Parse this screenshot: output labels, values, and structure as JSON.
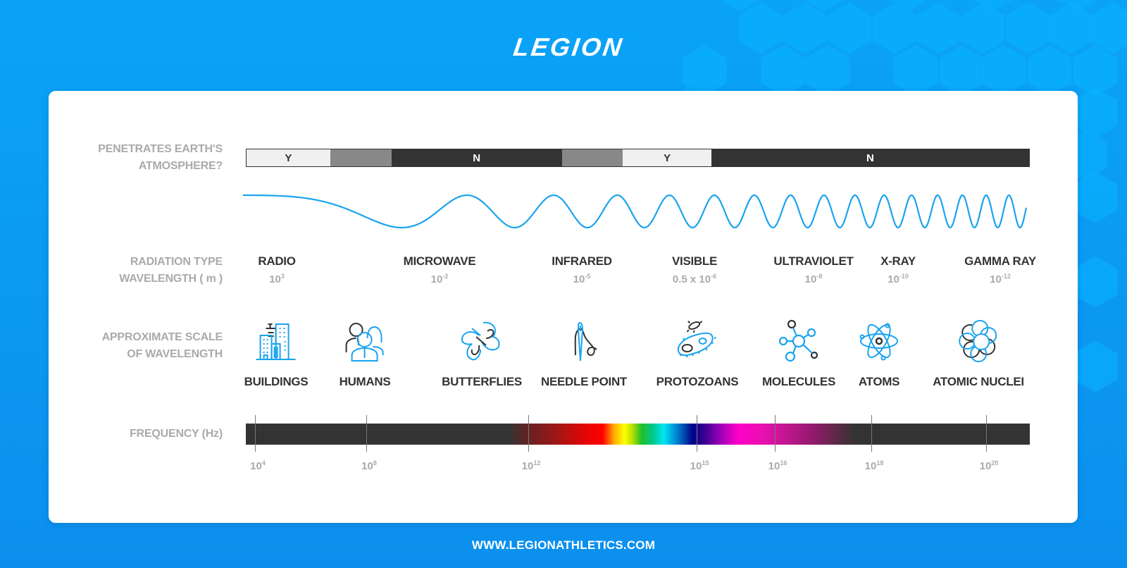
{
  "brand": {
    "logo_text": "LEGION",
    "website": "WWW.LEGIONATHLETICS.COM",
    "colors": {
      "background": "#0a9df5",
      "accent_blue": "#1aa3ef",
      "dark": "#333333",
      "muted": "#aaaaaa",
      "light": "#f0f0f0",
      "mid_gray": "#888888"
    }
  },
  "rows": {
    "atmosphere_label": [
      "PENETRATES EARTH'S",
      "ATMOSPHERE?"
    ],
    "radiation_label": [
      "RADIATION TYPE",
      "WAVELENGTH ( m )"
    ],
    "scale_label": [
      "APPROXIMATE SCALE",
      "OF WAVELENGTH"
    ],
    "frequency_label": "FREQUENCY (Hz)"
  },
  "atmosphere_segments": [
    {
      "label": "Y",
      "state": "yes",
      "share": 0.107
    },
    {
      "label": "",
      "state": "partial",
      "share": 0.078
    },
    {
      "label": "N",
      "state": "no",
      "share": 0.218
    },
    {
      "label": "",
      "state": "partial",
      "share": 0.078
    },
    {
      "label": "Y",
      "state": "yes",
      "share": 0.113
    },
    {
      "label": "N",
      "state": "no",
      "share": 0.406
    }
  ],
  "radiation_types": [
    {
      "name": "RADIO",
      "wl_base": "10",
      "wl_exp": "3"
    },
    {
      "name": "MICROWAVE",
      "wl_base": "10",
      "wl_exp": "-2"
    },
    {
      "name": "INFRARED",
      "wl_base": "10",
      "wl_exp": "-5"
    },
    {
      "name": "VISIBLE",
      "wl_base": "0.5 x 10",
      "wl_exp": "-6"
    },
    {
      "name": "ULTRAVIOLET",
      "wl_base": "10",
      "wl_exp": "-8"
    },
    {
      "name": "X-RAY",
      "wl_base": "10",
      "wl_exp": "-10"
    },
    {
      "name": "GAMMA RAY",
      "wl_base": "10",
      "wl_exp": "-12"
    }
  ],
  "scale_items": [
    {
      "label": "BUILDINGS",
      "icon": "buildings-icon"
    },
    {
      "label": "HUMANS",
      "icon": "humans-icon"
    },
    {
      "label": "BUTTERFLIES",
      "icon": "butterfly-icon"
    },
    {
      "label": "NEEDLE POINT",
      "icon": "needle-icon"
    },
    {
      "label": "PROTOZOANS",
      "icon": "protozoan-icon"
    },
    {
      "label": "MOLECULES",
      "icon": "molecule-icon"
    },
    {
      "label": "ATOMS",
      "icon": "atom-icon"
    },
    {
      "label": "ATOMIC NUCLEI",
      "icon": "nucleus-icon"
    }
  ],
  "frequency_ticks": [
    {
      "base": "10",
      "exp": "4"
    },
    {
      "base": "10",
      "exp": "8"
    },
    {
      "base": "10",
      "exp": "12"
    },
    {
      "base": "10",
      "exp": "15"
    },
    {
      "base": "10",
      "exp": "16"
    },
    {
      "base": "10",
      "exp": "18"
    },
    {
      "base": "10",
      "exp": "20"
    }
  ]
}
